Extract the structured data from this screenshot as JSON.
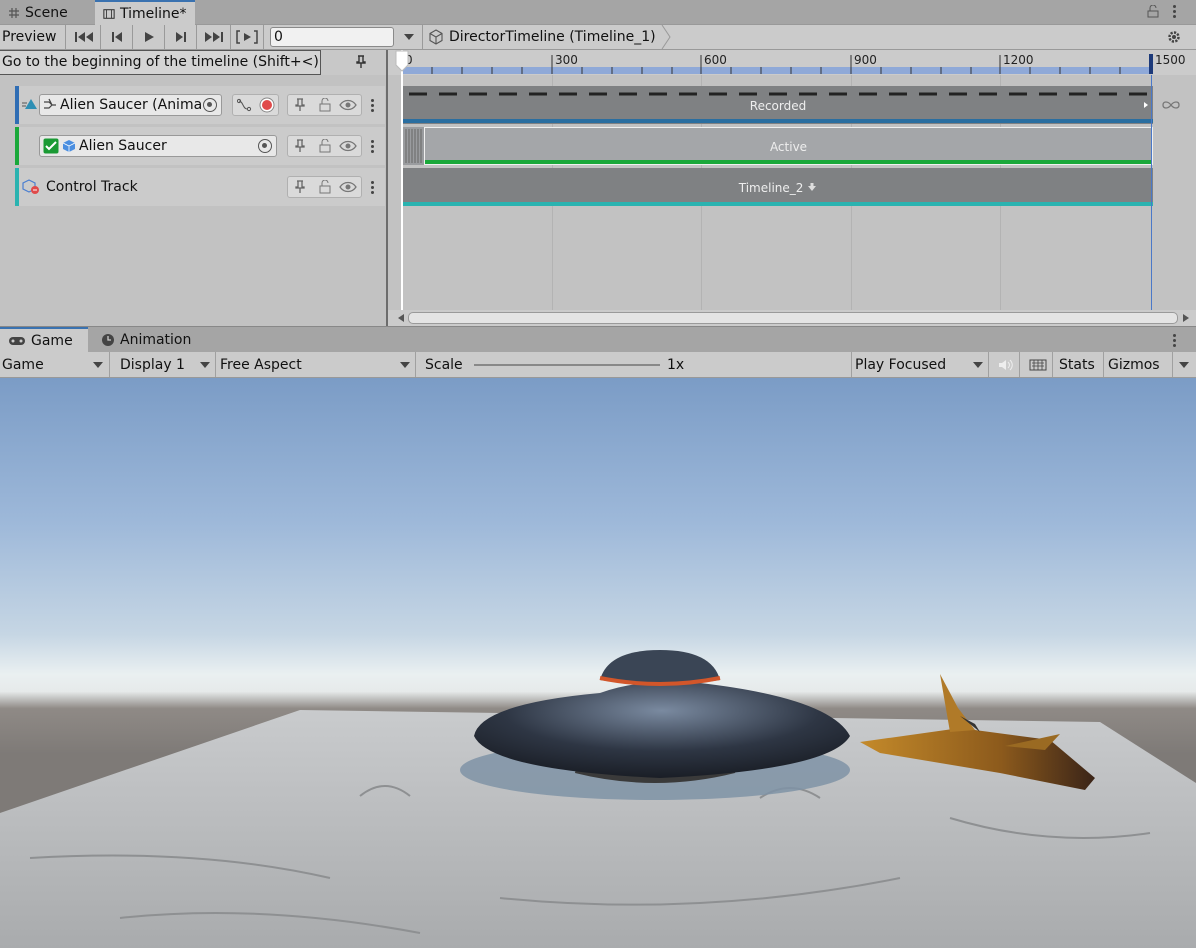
{
  "tabs": {
    "scene": "Scene",
    "timeline": "Timeline*"
  },
  "toolbar": {
    "preview": "Preview",
    "frame": "0",
    "director": "DirectorTimeline (Timeline_1)"
  },
  "tooltip": "Go to the beginning of the timeline (Shift+<)",
  "ruler": {
    "labels": [
      "0",
      "300",
      "600",
      "900",
      "1200",
      "1500"
    ]
  },
  "tracks": [
    {
      "name": "Alien Saucer (Anima",
      "clip": "Recorded",
      "color": "#2f6db4"
    },
    {
      "name": "Alien Saucer",
      "clip": "Active",
      "color": "#1aa83a"
    },
    {
      "name": "Control Track",
      "clip": "Timeline_2",
      "color": "#2ab3b0"
    }
  ],
  "game_tabs": {
    "game": "Game",
    "animation": "Animation"
  },
  "game_toolbar": {
    "mode": "Game",
    "display": "Display 1",
    "aspect": "Free Aspect",
    "scale_label": "Scale",
    "scale_value": "1x",
    "play_mode": "Play Focused",
    "stats": "Stats",
    "gizmos": "Gizmos"
  }
}
